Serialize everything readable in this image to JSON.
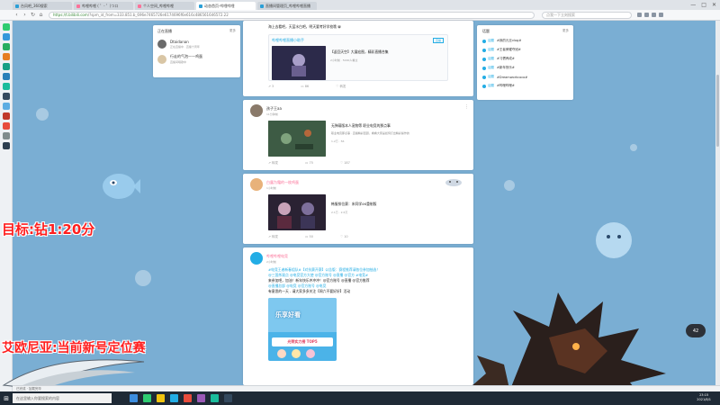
{
  "browser": {
    "tabs": [
      {
        "label": "台风吧_360搜索",
        "active": false
      },
      {
        "label": "哔哩哔哩 ( ゜- ゜)つロ",
        "active": false
      },
      {
        "label": "个人空间_哔哩哔哩",
        "active": false
      },
      {
        "label": "动态首页-哔哩哔哩",
        "active": true
      },
      {
        "label": "直播间管理页_哔哩哔哩直播",
        "active": false
      }
    ],
    "url_host": "https://t.bilibili.com",
    "url_path": "/?spm_id_from=333.851.b_696e7465726e6174696f6e616c486561646572.22",
    "search_placeholder": "点我一下立刻搜索",
    "window_controls": [
      "—",
      "□",
      "✕"
    ]
  },
  "follow_card": {
    "title": "正在直播",
    "more": "更多",
    "items": [
      {
        "name": "Dtaidanan",
        "sub": "正在直播中 · 直播十周年"
      },
      {
        "name": "行走的气泡——鸡蛋",
        "sub": "直播间唱歌中"
      }
    ]
  },
  "tag_card": {
    "title": "话题",
    "more": "更多",
    "items": [
      {
        "lbl": "话题",
        "text": "#我的元旦vlog#"
      },
      {
        "lbl": "话题",
        "text": "#王者荣耀夺冠#"
      },
      {
        "lbl": "话题",
        "text": "#习惯养成#"
      },
      {
        "lbl": "话题",
        "text": "#新年快乐#"
      },
      {
        "lbl": "话题",
        "text": "#Dreamworkcoco#"
      },
      {
        "lbl": "话题",
        "text": "#哔哩哔哩#"
      }
    ]
  },
  "feed": [
    {
      "intro": "海上去看吧，天蓝水白吧，明天要考好学校哦 😀",
      "embed_name": "哔哩哔哩直播小助手",
      "embed_tag": "直播",
      "embed_title": "【返回天空】大展宏图，精彩直播合集",
      "embed_meta": "2小时前 · 5000人看过",
      "actions": [
        "3",
        "86",
        "转发"
      ]
    },
    {
      "name": "孩子王aa",
      "time": "11分钟前",
      "video_title": "无弹幕版本人宠物等 职业电竞的那点事",
      "video_desc": "职业电竞那点事 · 直播精彩回顾，看看大家是如何打出精彩操作的",
      "video_stats": "1.2万 · 56",
      "actions": [
        "转发",
        "75",
        "187"
      ]
    },
    {
      "name": "白露为霜的一枚鸡蛋",
      "time": "1小时前",
      "video_title": "韩服排位赛：宋同学4K重制版",
      "video_stats": "2.1万 · 2.6万",
      "actions": [
        "转发",
        "50",
        "10"
      ]
    },
    {
      "name": "哔哩哔哩电竞",
      "time": "2小时前",
      "text_a": "#电竞王者新春组队#【对抗赛开赛】公告版：赛程推荐请各位参加抽选！",
      "text_b": "@三国杀观点 @电竞官方大使 @官方账号 @直播 @官方 #电竞#",
      "text_c": "来参加吧，加油！新年快乐冲冲冲！@官方账号 @直播 @官方推荐",
      "text_d": "@直播总部 @电竞 @官方账号 @电竞",
      "text_e": "有意思的一天 - 请大家多多关注【周六不要好好】活动",
      "poster_text": "乐享好看",
      "poster_sub": "光荣实力榜 TOP5",
      "actions": []
    }
  ],
  "overlay": {
    "goal": "目标:钻1:20分",
    "status": "艾欧尼亚:当前新号定位赛"
  },
  "statusbar_text": "已完成 · 加载完毕",
  "badge": "42",
  "taskbar": {
    "search": "在这里输入你要搜索的内容",
    "time": "23:15",
    "date": "2021/8/1"
  },
  "colors": {
    "bilibili_blue": "#23ade5",
    "bilibili_pink": "#fb7299",
    "overlay_red": "#ff1e1e"
  }
}
